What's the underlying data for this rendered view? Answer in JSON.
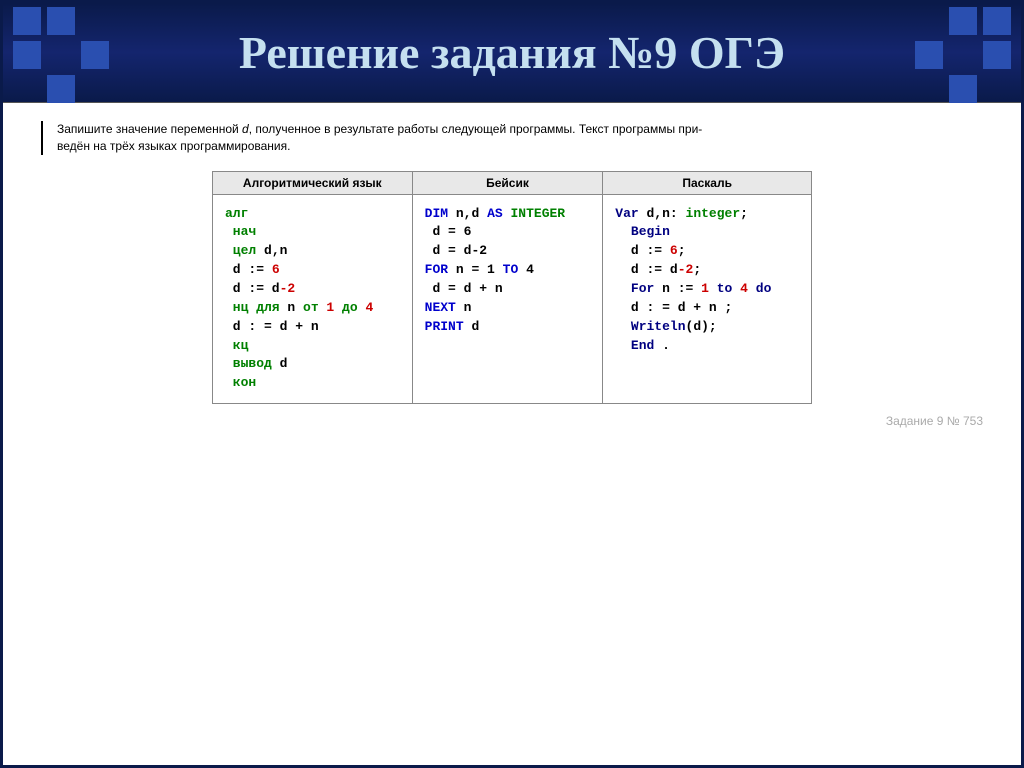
{
  "header": {
    "title": "Решение задания №9 ОГЭ"
  },
  "task": {
    "line1_prefix": "Запишите значение переменной ",
    "line1_var": "d",
    "line1_suffix": ", полученное в результате работы следующей программы. Текст программы при-",
    "line2": "ведён на трёх языках программирования."
  },
  "columns": {
    "algo": "Алгоритмический язык",
    "basic": "Бейсик",
    "pascal": "Паскаль"
  },
  "code": {
    "algo": {
      "l1": "алг",
      "l2": " нач",
      "l3_k": " цел",
      "l3_v": " d,n",
      "l4_a": " d := ",
      "l4_b": "6",
      "l5_a": " d := d",
      "l5_b": "-2",
      "l6_a": " нц для",
      "l6_b": " n ",
      "l6_c": "от",
      "l6_d": " 1 ",
      "l6_e": "до",
      "l6_f": " 4",
      "l7": " d : = d + n",
      "l8": " кц",
      "l9_a": " вывод",
      "l9_b": " d",
      "l10": " кон"
    },
    "basic": {
      "l1_a": "DIM",
      "l1_b": " n,d ",
      "l1_c": "AS",
      "l1_d": " ",
      "l1_e": "INTEGER",
      "l2": " d = 6",
      "l3": " d = d-2",
      "l4_a": "FOR",
      "l4_b": " n = 1 ",
      "l4_c": "TO",
      "l4_d": " 4",
      "l5": " d = d + n",
      "l6_a": "NEXT",
      "l6_b": " n",
      "l7_a": "PRINT",
      "l7_b": " d"
    },
    "pascal": {
      "l1_a": "Var",
      "l1_b": " d,n: ",
      "l1_c": "integer",
      "l1_d": ";",
      "l2": "  Begin",
      "l3_a": "  d := ",
      "l3_b": "6",
      "l3_c": ";",
      "l4_a": "  d := d",
      "l4_b": "-2",
      "l4_c": ";",
      "l5_a": "  For",
      "l5_b": " n := ",
      "l5_c": "1",
      "l5_d": " to ",
      "l5_e": "4",
      "l5_f": " do",
      "l6": "  d : = d + n ;",
      "l7_a": "  Writeln",
      "l7_b": "(d);",
      "l8_a": "  End",
      "l8_b": " ."
    }
  },
  "footer": {
    "task_id": "Задание 9 № 753"
  }
}
